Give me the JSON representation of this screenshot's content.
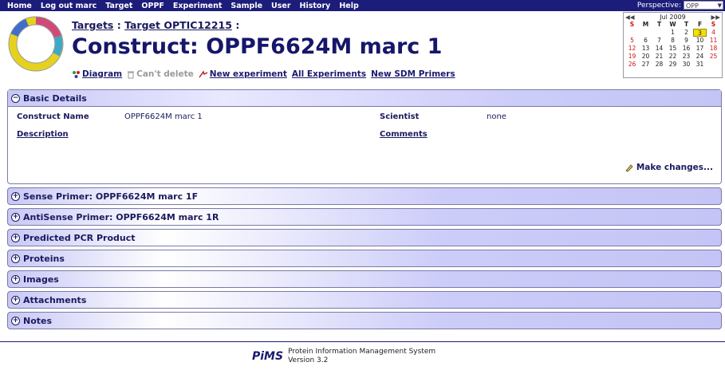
{
  "nav": {
    "items": [
      "Home",
      "Log out marc",
      "Target",
      "OPPF",
      "Experiment",
      "Sample",
      "User",
      "History",
      "Help"
    ],
    "perspective_label": "Perspective:",
    "perspective_value": "OPP"
  },
  "breadcrumb": {
    "targets": "Targets",
    "sep1": " : ",
    "target": "Target OPTIC12215",
    "sep2": " :"
  },
  "title": "Construct: OPPF6624M marc 1",
  "actions": {
    "diagram": "Diagram",
    "cant_delete": "Can't delete",
    "new_experiment": "New experiment",
    "all_experiments": "All Experiments",
    "new_sdm_primers": "New SDM Primers"
  },
  "calendar": {
    "title": "Jul 2009",
    "days_of_week": [
      "S",
      "M",
      "T",
      "W",
      "T",
      "F",
      "S"
    ],
    "weeks": [
      [
        "",
        "",
        "",
        "1",
        "2",
        "3",
        "4"
      ],
      [
        "5",
        "6",
        "7",
        "8",
        "9",
        "10",
        "11"
      ],
      [
        "12",
        "13",
        "14",
        "15",
        "16",
        "17",
        "18"
      ],
      [
        "19",
        "20",
        "21",
        "22",
        "23",
        "24",
        "25"
      ],
      [
        "26",
        "27",
        "28",
        "29",
        "30",
        "31",
        ""
      ]
    ],
    "today": "3"
  },
  "basic": {
    "header": "Basic Details",
    "construct_name_label": "Construct Name",
    "construct_name_value": "OPPF6624M marc 1",
    "scientist_label": "Scientist",
    "scientist_value": "none",
    "description_label": "Description",
    "comments_label": "Comments",
    "make_changes": "Make changes..."
  },
  "sections": [
    "Sense Primer: OPPF6624M marc 1F",
    "AntiSense Primer: OPPF6624M marc 1R",
    "Predicted PCR Product",
    "Proteins",
    "Images",
    "Attachments",
    "Notes"
  ],
  "footer": {
    "logo": "PiMS",
    "line1": "Protein Information Management System",
    "line2": "Version 3.2"
  },
  "colors": {
    "nav_bg": "#1c1c7a",
    "panel_head": "#c8c8f6",
    "today": "#f3e100",
    "weekend": "#c81414"
  }
}
